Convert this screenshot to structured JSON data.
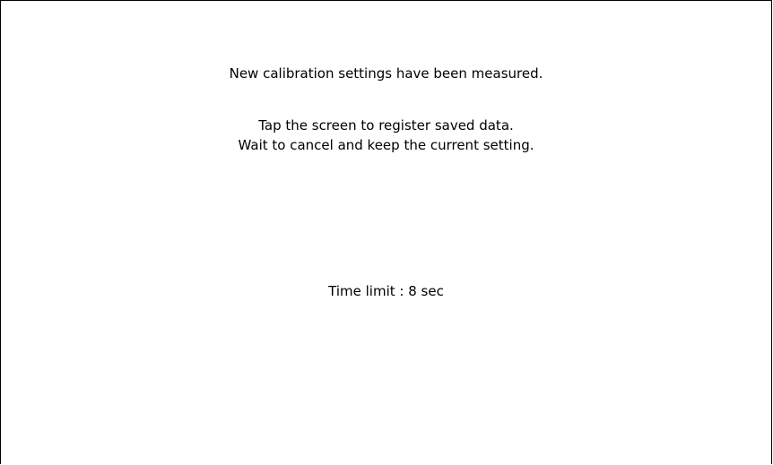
{
  "dialog": {
    "measured_message": "New calibration settings have been measured.",
    "tap_instruction": "Tap the screen to register saved data.",
    "wait_instruction": "Wait to cancel and keep the current setting.",
    "time_limit_text": "Time limit : 8 sec"
  },
  "colors": {
    "background": "#ffffff",
    "text": "#000000",
    "border": "#000000"
  }
}
